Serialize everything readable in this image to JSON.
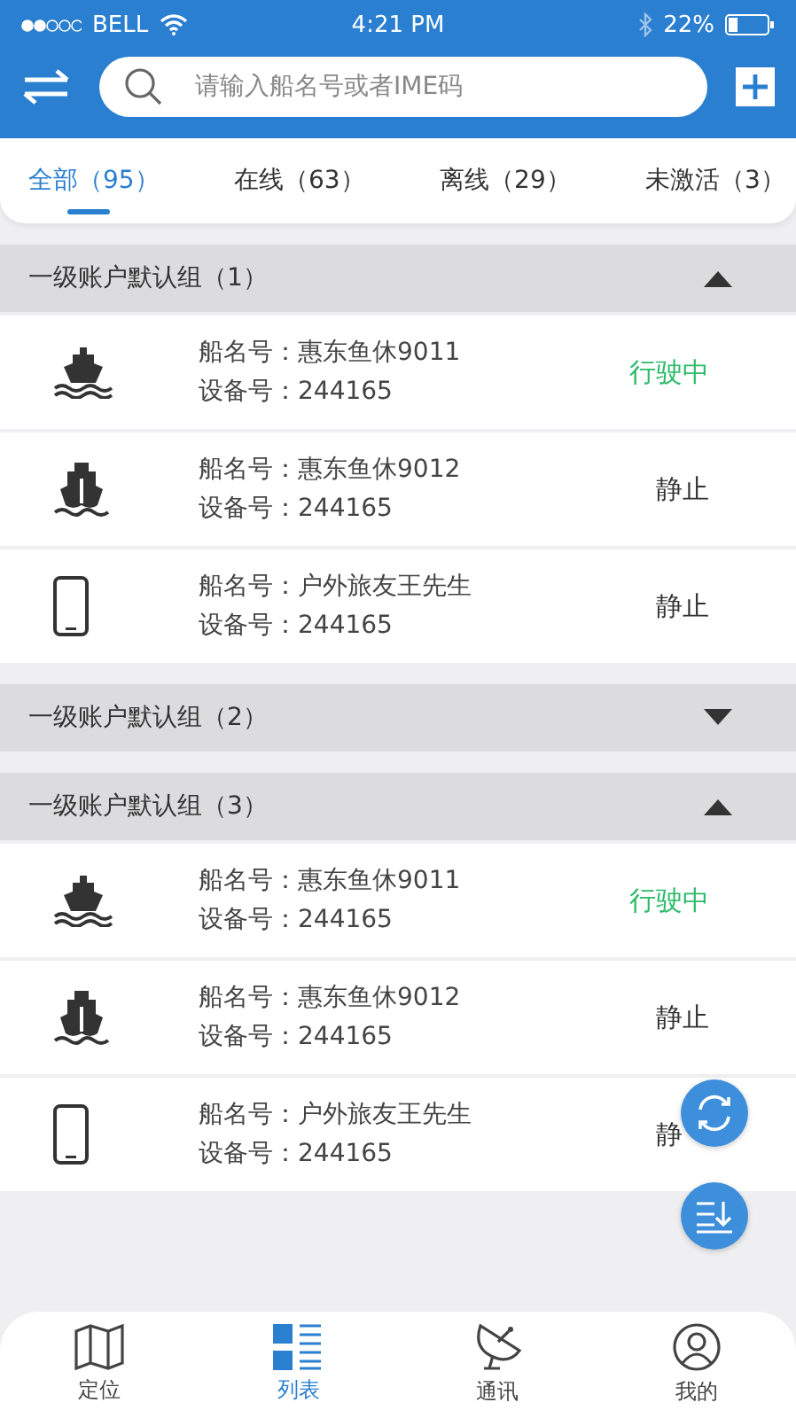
{
  "status_bar": {
    "carrier": "BELL",
    "time": "4:21 PM",
    "battery": "22%"
  },
  "search": {
    "placeholder": "请输入船名号或者IME码"
  },
  "tabs": [
    {
      "label": "全部（95）",
      "selected": true
    },
    {
      "label": "在线（63）",
      "selected": false
    },
    {
      "label": "离线（29）",
      "selected": false
    },
    {
      "label": "未激活（3）",
      "selected": false
    }
  ],
  "groups": [
    {
      "title": "一级账户默认组（1）",
      "expanded": true,
      "items": [
        {
          "kind": "ship",
          "name_label": "船名号：惠东鱼休9011",
          "device_label": "设备号：244165",
          "status": "行驶中",
          "color": "#2dbb6a"
        },
        {
          "kind": "ship-front",
          "name_label": "船名号：惠东鱼休9012",
          "device_label": "设备号：244165",
          "status": "静止",
          "color": "#333333"
        },
        {
          "kind": "phone",
          "name_label": "船名号：户外旅友王先生",
          "device_label": "设备号：244165",
          "status": "静止",
          "color": "#333333"
        }
      ]
    },
    {
      "title": "一级账户默认组（2）",
      "expanded": false
    },
    {
      "title": "一级账户默认组（3）",
      "expanded": true,
      "items": [
        {
          "kind": "ship",
          "name_label": "船名号：惠东鱼休9011",
          "device_label": "设备号：244165",
          "status": "行驶中",
          "color": "#2dbb6a"
        },
        {
          "kind": "ship-front",
          "name_label": "船名号：惠东鱼休9012",
          "device_label": "设备号：244165",
          "status": "静止",
          "color": "#333333"
        },
        {
          "kind": "phone",
          "name_label": "船名号：户外旅友王先生",
          "device_label": "设备号：244165",
          "status": "静",
          "color": "#333333"
        }
      ]
    }
  ],
  "nav": [
    {
      "kind": "map",
      "label": "定位",
      "selected": false
    },
    {
      "kind": "list",
      "label": "列表",
      "selected": true
    },
    {
      "kind": "dish",
      "label": "通讯",
      "selected": false
    },
    {
      "kind": "user",
      "label": "我的",
      "selected": false
    }
  ]
}
